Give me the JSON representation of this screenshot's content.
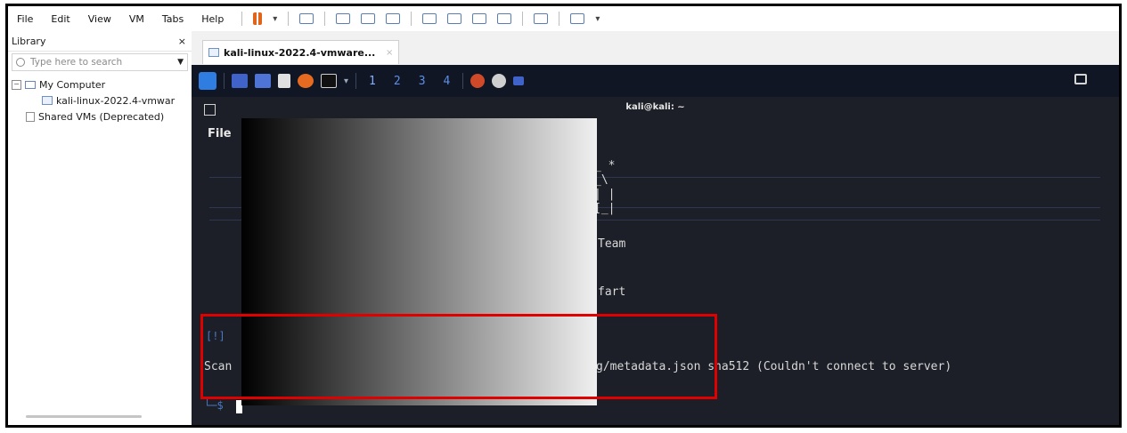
{
  "menubar": {
    "items": [
      "File",
      "Edit",
      "View",
      "VM",
      "Tabs",
      "Help"
    ]
  },
  "library": {
    "title": "Library",
    "close_label": "×",
    "search_placeholder": "Type here to search",
    "tree": {
      "my_computer": "My Computer",
      "vm": "kali-linux-2022.4-vmwar",
      "shared": "Shared VMs (Deprecated)"
    }
  },
  "tab": {
    "label": "kali-linux-2022.4-vmware...",
    "close": "×"
  },
  "kali_panel": {
    "workspaces": [
      "1",
      "2",
      "3",
      "4"
    ]
  },
  "terminal": {
    "title": "kali@kali: ~",
    "file_menu": "File",
    "ascii_lines": [
      "_ *",
      "_\\",
      "| |",
      "[_|"
    ],
    "team_text": "Team",
    "fart_text": "fart",
    "status_prefix": "[!]",
    "scan_prefix": "Scan",
    "scan_suffix": "g/metadata.json sha512 (Couldn't connect to server)",
    "prompt": "└─$"
  }
}
